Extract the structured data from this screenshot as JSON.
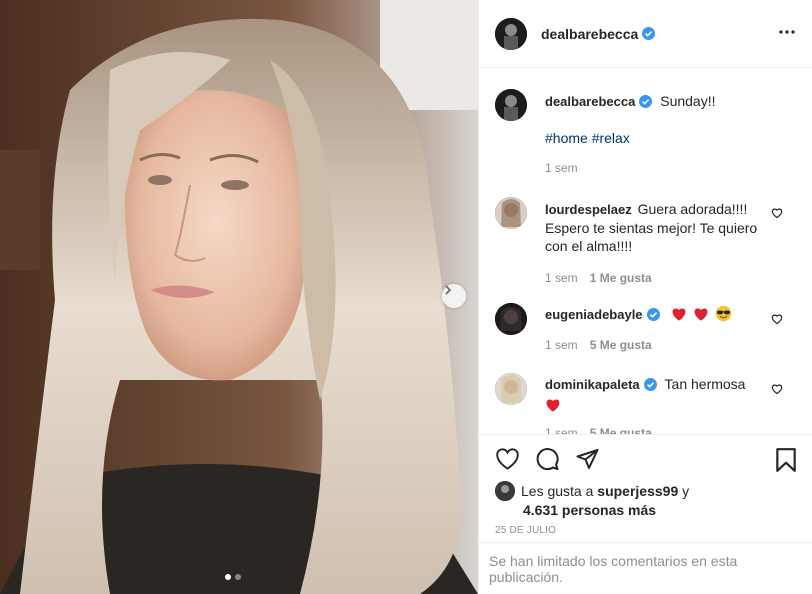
{
  "post": {
    "carousel": {
      "slide_count": 2,
      "active_slide": 1
    }
  },
  "header": {
    "username": "dealbarebecca",
    "verified": true,
    "more_icon": "more-horizontal-icon"
  },
  "caption": {
    "username": "dealbarebecca",
    "text": "Sunday!!",
    "hashtags": "#home #relax",
    "time": "1 sem"
  },
  "comments": [
    {
      "username": "lourdespelaez",
      "verified": false,
      "text": "Guera adorada!!!! Espero te sientas mejor! Te quiero con el alma!!!!",
      "time": "1 sem",
      "likes": "1 Me gusta"
    },
    {
      "username": "eugeniadebayle",
      "verified": true,
      "text": "",
      "emojis": [
        "red-heart",
        "red-heart",
        "sunglasses-face"
      ],
      "time": "1 sem",
      "likes": "5 Me gusta"
    },
    {
      "username": "dominikapaleta",
      "verified": true,
      "text": "Tan hermosa",
      "emojis": [
        "red-heart"
      ],
      "time": "1 sem",
      "likes": "5 Me gusta"
    }
  ],
  "actions": {
    "icons": [
      "heart-icon",
      "comment-icon",
      "share-icon",
      "bookmark-icon"
    ]
  },
  "likes": {
    "prefix": "Les gusta a",
    "user": "superjess99",
    "connector": "y",
    "count": "4.631 personas más"
  },
  "date": "25 DE JULIO",
  "footer_text": "Se han limitado los comentarios en esta publicación.",
  "colors": {
    "verified": "#3897f0",
    "hashtag": "#00376b",
    "muted": "#8e8e8e",
    "heart": "#ed4956"
  }
}
